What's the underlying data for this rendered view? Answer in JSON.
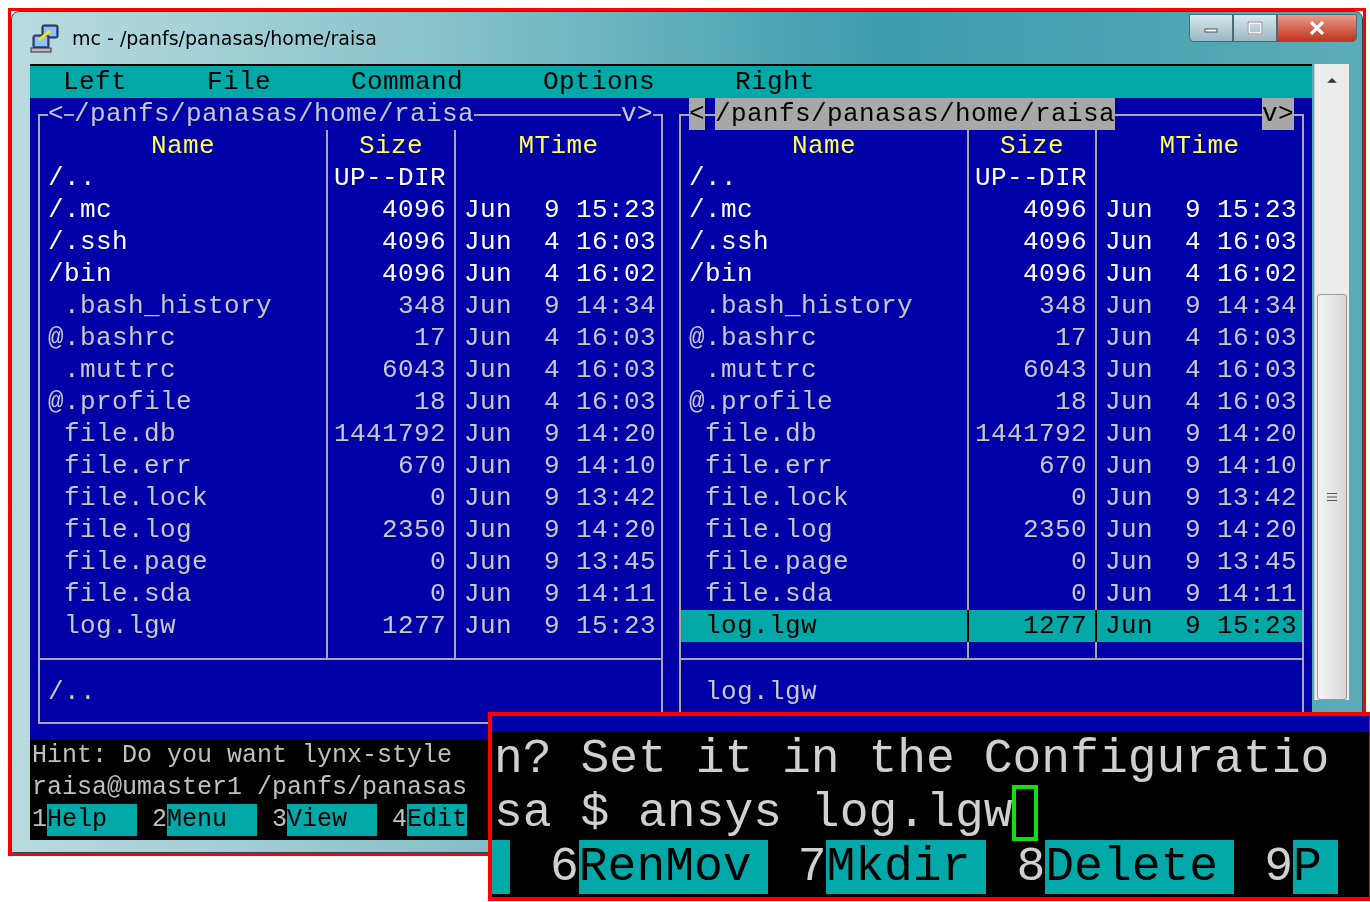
{
  "window": {
    "title": "mc - /panfs/panasas/home/raisa"
  },
  "menu": [
    {
      "label": "Left"
    },
    {
      "label": "File"
    },
    {
      "label": "Command"
    },
    {
      "label": "Options"
    },
    {
      "label": "Right"
    }
  ],
  "panels": [
    {
      "active": false,
      "nav_left": "<",
      "path": "/panfs/panasas/home/raisa",
      "nav_right": "v>",
      "columns": [
        "Name",
        "Size",
        "MTime"
      ],
      "rows": [
        {
          "name": "/..",
          "size": "UP--DIR",
          "mtime": "",
          "kind": "dir",
          "selected": false
        },
        {
          "name": "/.mc",
          "size": "4096",
          "mtime": "Jun  9 15:23",
          "kind": "dir",
          "selected": false
        },
        {
          "name": "/.ssh",
          "size": "4096",
          "mtime": "Jun  4 16:03",
          "kind": "dir",
          "selected": false
        },
        {
          "name": "/bin",
          "size": "4096",
          "mtime": "Jun  4 16:02",
          "kind": "dir",
          "selected": false
        },
        {
          "name": " .bash_history",
          "size": "348",
          "mtime": "Jun  9 14:34",
          "kind": "file",
          "selected": false
        },
        {
          "name": "@.bashrc",
          "size": "17",
          "mtime": "Jun  4 16:03",
          "kind": "file",
          "selected": false
        },
        {
          "name": " .muttrc",
          "size": "6043",
          "mtime": "Jun  4 16:03",
          "kind": "file",
          "selected": false
        },
        {
          "name": "@.profile",
          "size": "18",
          "mtime": "Jun  4 16:03",
          "kind": "file",
          "selected": false
        },
        {
          "name": " file.db",
          "size": "1441792",
          "mtime": "Jun  9 14:20",
          "kind": "file",
          "selected": false
        },
        {
          "name": " file.err",
          "size": "670",
          "mtime": "Jun  9 14:10",
          "kind": "file",
          "selected": false
        },
        {
          "name": " file.lock",
          "size": "0",
          "mtime": "Jun  9 13:42",
          "kind": "file",
          "selected": false
        },
        {
          "name": " file.log",
          "size": "2350",
          "mtime": "Jun  9 14:20",
          "kind": "file",
          "selected": false
        },
        {
          "name": " file.page",
          "size": "0",
          "mtime": "Jun  9 13:45",
          "kind": "file",
          "selected": false
        },
        {
          "name": " file.sda",
          "size": "0",
          "mtime": "Jun  9 14:11",
          "kind": "file",
          "selected": false
        },
        {
          "name": " log.lgw",
          "size": "1277",
          "mtime": "Jun  9 15:23",
          "kind": "file",
          "selected": false
        }
      ],
      "mini_status": "/.."
    },
    {
      "active": true,
      "nav_left": "<",
      "path": "/panfs/panasas/home/raisa",
      "nav_right": "v>",
      "columns": [
        "Name",
        "Size",
        "MTime"
      ],
      "rows": [
        {
          "name": "/..",
          "size": "UP--DIR",
          "mtime": "",
          "kind": "dir",
          "selected": false
        },
        {
          "name": "/.mc",
          "size": "4096",
          "mtime": "Jun  9 15:23",
          "kind": "dir",
          "selected": false
        },
        {
          "name": "/.ssh",
          "size": "4096",
          "mtime": "Jun  4 16:03",
          "kind": "dir",
          "selected": false
        },
        {
          "name": "/bin",
          "size": "4096",
          "mtime": "Jun  4 16:02",
          "kind": "dir",
          "selected": false
        },
        {
          "name": " .bash_history",
          "size": "348",
          "mtime": "Jun  9 14:34",
          "kind": "file",
          "selected": false
        },
        {
          "name": "@.bashrc",
          "size": "17",
          "mtime": "Jun  4 16:03",
          "kind": "file",
          "selected": false
        },
        {
          "name": " .muttrc",
          "size": "6043",
          "mtime": "Jun  4 16:03",
          "kind": "file",
          "selected": false
        },
        {
          "name": "@.profile",
          "size": "18",
          "mtime": "Jun  4 16:03",
          "kind": "file",
          "selected": false
        },
        {
          "name": " file.db",
          "size": "1441792",
          "mtime": "Jun  9 14:20",
          "kind": "file",
          "selected": false
        },
        {
          "name": " file.err",
          "size": "670",
          "mtime": "Jun  9 14:10",
          "kind": "file",
          "selected": false
        },
        {
          "name": " file.lock",
          "size": "0",
          "mtime": "Jun  9 13:42",
          "kind": "file",
          "selected": false
        },
        {
          "name": " file.log",
          "size": "2350",
          "mtime": "Jun  9 14:20",
          "kind": "file",
          "selected": false
        },
        {
          "name": " file.page",
          "size": "0",
          "mtime": "Jun  9 13:45",
          "kind": "file",
          "selected": false
        },
        {
          "name": " file.sda",
          "size": "0",
          "mtime": "Jun  9 14:11",
          "kind": "file",
          "selected": false
        },
        {
          "name": " log.lgw",
          "size": "1277",
          "mtime": "Jun  9 15:23",
          "kind": "file",
          "selected": true
        }
      ],
      "mini_status": " log.lgw"
    }
  ],
  "hint": "Hint: Do you want lynx-style",
  "prompt": "raisa@umaster1 /panfs/panasas",
  "function_keys": [
    {
      "number": "1",
      "label": "Help"
    },
    {
      "number": "2",
      "label": "Menu"
    },
    {
      "number": "3",
      "label": "View"
    },
    {
      "number": "4",
      "label": "Edit"
    }
  ],
  "zoom_inset": {
    "hint": "n? Set it in the Configuratio",
    "prompt": "sa $ ansys log.lgw",
    "function_keys": [
      {
        "number": "6",
        "label": "RenMov"
      },
      {
        "number": "7",
        "label": "Mkdir"
      },
      {
        "number": "8",
        "label": "Delete"
      },
      {
        "number": "9",
        "label": "P"
      }
    ]
  }
}
